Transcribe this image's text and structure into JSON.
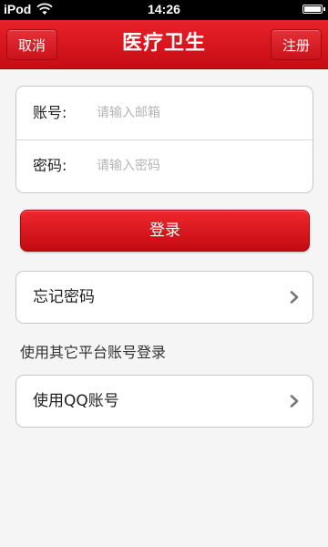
{
  "status_bar": {
    "carrier": "iPod",
    "time": "14:26",
    "wifi_icon": "wifi-icon",
    "battery_icon": "battery-icon",
    "battery_level": 1.0
  },
  "nav": {
    "title": "医疗卫生",
    "left_button": "取消",
    "right_button": "注册",
    "color": "#d4141b"
  },
  "login_form": {
    "account_label": "账号:",
    "account_placeholder": "请输入邮箱",
    "account_value": "",
    "password_label": "密码:",
    "password_placeholder": "请输入密码",
    "password_value": ""
  },
  "login_button": "登录",
  "forgot_password": {
    "label": "忘记密码",
    "icon": "chevron-right-icon"
  },
  "other_platforms_text": "使用其它平台账号登录",
  "qq_login": {
    "label": "使用QQ账号",
    "icon": "chevron-right-icon"
  }
}
